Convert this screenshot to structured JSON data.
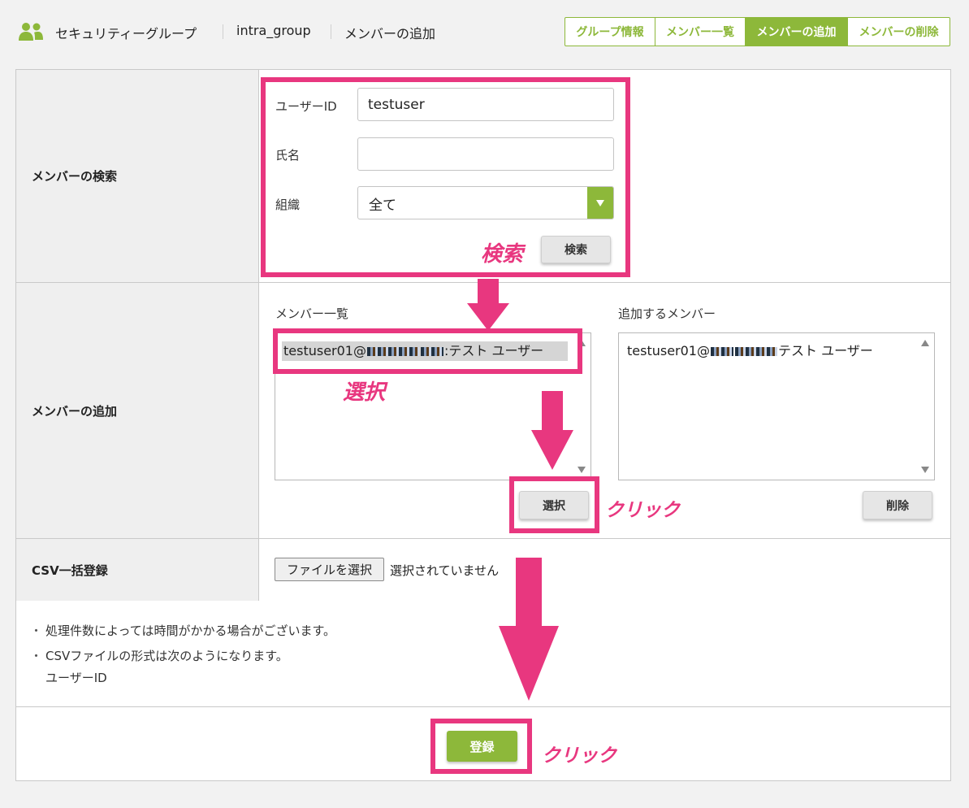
{
  "header": {
    "crumbs": [
      "セキュリティーグループ",
      "intra_group",
      "メンバーの追加"
    ],
    "tabs": [
      {
        "label": "グループ情報",
        "active": false
      },
      {
        "label": "メンバー一覧",
        "active": false
      },
      {
        "label": "メンバーの追加",
        "active": true
      },
      {
        "label": "メンバーの削除",
        "active": false
      }
    ]
  },
  "search": {
    "section_label": "メンバーの検索",
    "user_id_label": "ユーザーID",
    "user_id_value": "testuser",
    "name_label": "氏名",
    "name_value": "",
    "org_label": "組織",
    "org_value": "全て",
    "search_button": "検索"
  },
  "add": {
    "section_label": "メンバーの追加",
    "list_title": "メンバー一覧",
    "list_items": [
      {
        "prefix": "testuser01@",
        "suffix": ":テスト ユーザー"
      }
    ],
    "selected_title": "追加するメンバー",
    "selected_items": [
      {
        "prefix": "testuser01@",
        "suffix": "テスト ユーザー"
      }
    ],
    "select_button": "選択",
    "delete_button": "削除"
  },
  "csv": {
    "section_label": "CSV一括登録",
    "file_button": "ファイルを選択",
    "file_status": "選択されていません"
  },
  "notes": {
    "bullet": "・",
    "line1": "処理件数によっては時間がかかる場合がございます。",
    "line2": "CSVファイルの形式は次のようになります。",
    "line3": "ユーザーID"
  },
  "submit": {
    "label": "登録"
  },
  "annotations": {
    "search": "検索",
    "select": "選択",
    "click1": "クリック",
    "click2": "クリック"
  },
  "colors": {
    "accent": "#8db83a",
    "highlight": "#e8377f"
  }
}
